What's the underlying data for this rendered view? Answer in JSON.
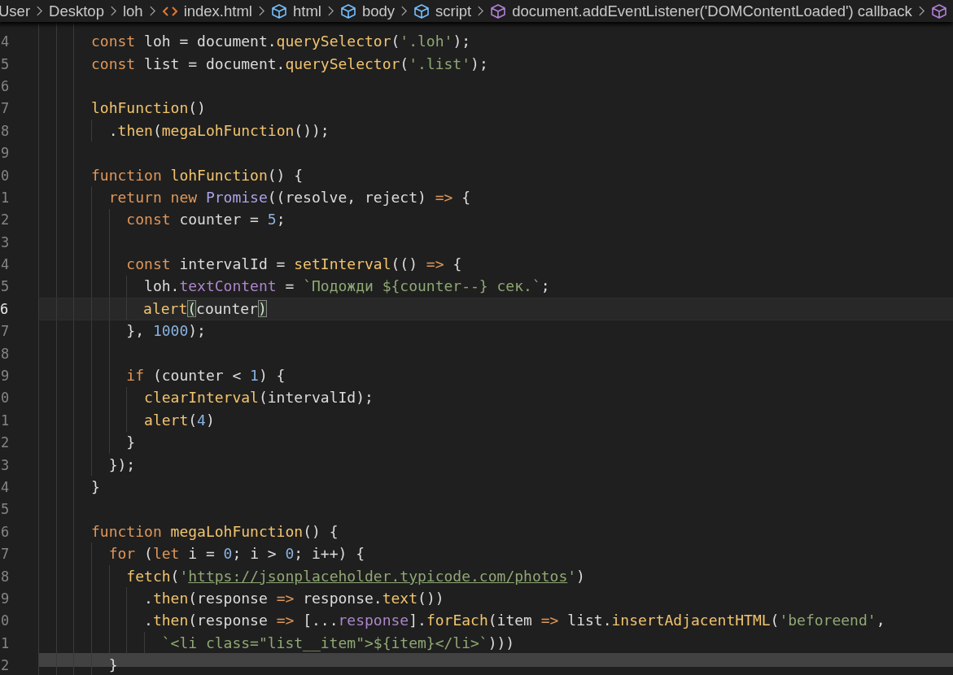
{
  "breadcrumb": [
    {
      "label": "User",
      "kind": "path"
    },
    {
      "label": "Desktop",
      "kind": "path"
    },
    {
      "label": "loh",
      "kind": "path"
    },
    {
      "label": "index.html",
      "kind": "file"
    },
    {
      "label": "html",
      "kind": "element"
    },
    {
      "label": "body",
      "kind": "element"
    },
    {
      "label": "script",
      "kind": "element"
    },
    {
      "label": "document.addEventListener('DOMContentLoaded') callback",
      "kind": "method"
    },
    {
      "kind": "method"
    }
  ],
  "lines": [
    {
      "number": "4",
      "current": false,
      "tokens": [
        {
          "text": "      const",
          "kind": "keyword"
        },
        {
          "text": " loh = document.",
          "kind": "plain"
        },
        {
          "text": "querySelector",
          "kind": "function"
        },
        {
          "text": "(",
          "kind": "plain"
        },
        {
          "text": "'.loh'",
          "kind": "string"
        },
        {
          "text": ");",
          "kind": "plain"
        }
      ]
    },
    {
      "number": "5",
      "current": false,
      "tokens": [
        {
          "text": "      const",
          "kind": "keyword"
        },
        {
          "text": " list = document.",
          "kind": "plain"
        },
        {
          "text": "querySelector",
          "kind": "function"
        },
        {
          "text": "(",
          "kind": "plain"
        },
        {
          "text": "'.list'",
          "kind": "string"
        },
        {
          "text": ");",
          "kind": "plain"
        }
      ]
    },
    {
      "number": "6",
      "current": false
    },
    {
      "number": "7",
      "current": false,
      "tokens": [
        {
          "text": "      lohFunction",
          "kind": "function"
        },
        {
          "text": "()",
          "kind": "plain"
        }
      ]
    },
    {
      "number": "8",
      "current": false,
      "tokens": [
        {
          "text": "        .",
          "kind": "plain"
        },
        {
          "text": "then",
          "kind": "function"
        },
        {
          "text": "(",
          "kind": "plain"
        },
        {
          "text": "megaLohFunction",
          "kind": "function"
        },
        {
          "text": "());",
          "kind": "plain"
        }
      ]
    },
    {
      "number": "9",
      "current": false
    },
    {
      "number": "0",
      "current": false,
      "tokens": [
        {
          "text": "      function ",
          "kind": "keyword"
        },
        {
          "text": "lohFunction",
          "kind": "function"
        },
        {
          "text": "() {",
          "kind": "plain"
        }
      ]
    },
    {
      "number": "1",
      "current": false,
      "tokens": [
        {
          "text": "        return new ",
          "kind": "keyword"
        },
        {
          "text": "Promise",
          "kind": "class"
        },
        {
          "text": "((resolve, reject) ",
          "kind": "plain"
        },
        {
          "text": "=>",
          "kind": "keyword"
        },
        {
          "text": " {",
          "kind": "plain"
        }
      ]
    },
    {
      "number": "2",
      "current": false,
      "tokens": [
        {
          "text": "          const",
          "kind": "keyword"
        },
        {
          "text": " counter = ",
          "kind": "plain"
        },
        {
          "text": "5",
          "kind": "number"
        },
        {
          "text": ";",
          "kind": "plain"
        }
      ]
    },
    {
      "number": "3",
      "current": false
    },
    {
      "number": "4",
      "current": false,
      "tokens": [
        {
          "text": "          const",
          "kind": "keyword"
        },
        {
          "text": " intervalId = ",
          "kind": "plain"
        },
        {
          "text": "setInterval",
          "kind": "function"
        },
        {
          "text": "(() ",
          "kind": "plain"
        },
        {
          "text": "=>",
          "kind": "keyword"
        },
        {
          "text": " {",
          "kind": "plain"
        }
      ]
    },
    {
      "number": "5",
      "current": false,
      "tokens": [
        {
          "text": "            loh.",
          "kind": "plain"
        },
        {
          "text": "textContent",
          "kind": "property"
        },
        {
          "text": " = ",
          "kind": "plain"
        },
        {
          "text": "`Подожди ${counter--} сек.`",
          "kind": "string"
        },
        {
          "text": ";",
          "kind": "plain"
        }
      ]
    },
    {
      "number": "6",
      "current": true,
      "tokens": [
        {
          "text": "            alert",
          "kind": "function"
        },
        {
          "text": "(",
          "kind": "matched-bracket"
        },
        {
          "text": "counter",
          "kind": "plain"
        },
        {
          "text": ")",
          "kind": "matched-bracket"
        }
      ]
    },
    {
      "number": "7",
      "current": false,
      "tokens": [
        {
          "text": "          }, ",
          "kind": "plain"
        },
        {
          "text": "1000",
          "kind": "number"
        },
        {
          "text": ");",
          "kind": "plain"
        }
      ]
    },
    {
      "number": "8",
      "current": false
    },
    {
      "number": "9",
      "current": false,
      "tokens": [
        {
          "text": "          if",
          "kind": "keyword"
        },
        {
          "text": " (counter < ",
          "kind": "plain"
        },
        {
          "text": "1",
          "kind": "number"
        },
        {
          "text": ") {",
          "kind": "plain"
        }
      ]
    },
    {
      "number": "0",
      "current": false,
      "tokens": [
        {
          "text": "            clearInterval",
          "kind": "function"
        },
        {
          "text": "(intervalId);",
          "kind": "plain"
        }
      ]
    },
    {
      "number": "1",
      "current": false,
      "tokens": [
        {
          "text": "            alert",
          "kind": "function"
        },
        {
          "text": "(",
          "kind": "plain"
        },
        {
          "text": "4",
          "kind": "number"
        },
        {
          "text": ")",
          "kind": "plain"
        }
      ]
    },
    {
      "number": "2",
      "current": false,
      "tokens": [
        {
          "text": "          }",
          "kind": "plain"
        }
      ]
    },
    {
      "number": "3",
      "current": false,
      "tokens": [
        {
          "text": "        });",
          "kind": "plain"
        }
      ]
    },
    {
      "number": "4",
      "current": false,
      "tokens": [
        {
          "text": "      }",
          "kind": "plain"
        }
      ]
    },
    {
      "number": "5",
      "current": false
    },
    {
      "number": "6",
      "current": false,
      "tokens": [
        {
          "text": "      function ",
          "kind": "keyword"
        },
        {
          "text": "megaLohFunction",
          "kind": "function"
        },
        {
          "text": "() {",
          "kind": "plain"
        }
      ]
    },
    {
      "number": "7",
      "current": false,
      "tokens": [
        {
          "text": "        for",
          "kind": "keyword"
        },
        {
          "text": " (",
          "kind": "plain"
        },
        {
          "text": "let",
          "kind": "keyword"
        },
        {
          "text": " i = ",
          "kind": "plain"
        },
        {
          "text": "0",
          "kind": "number"
        },
        {
          "text": "; i > ",
          "kind": "plain"
        },
        {
          "text": "0",
          "kind": "number"
        },
        {
          "text": "; i++) {",
          "kind": "plain"
        }
      ]
    },
    {
      "number": "8",
      "current": false,
      "tokens": [
        {
          "text": "          fetch",
          "kind": "function"
        },
        {
          "text": "(",
          "kind": "plain"
        },
        {
          "text": "'",
          "kind": "string"
        },
        {
          "text": "https://jsonplaceholder.typicode.com/photos",
          "kind": "link"
        },
        {
          "text": "'",
          "kind": "string"
        },
        {
          "text": ")",
          "kind": "plain"
        }
      ]
    },
    {
      "number": "9",
      "current": false,
      "tokens": [
        {
          "text": "            .",
          "kind": "plain"
        },
        {
          "text": "then",
          "kind": "function"
        },
        {
          "text": "(response ",
          "kind": "plain"
        },
        {
          "text": "=>",
          "kind": "keyword"
        },
        {
          "text": " response.",
          "kind": "plain"
        },
        {
          "text": "text",
          "kind": "function"
        },
        {
          "text": "())",
          "kind": "plain"
        }
      ]
    },
    {
      "number": "0",
      "current": false,
      "tokens": [
        {
          "text": "            .",
          "kind": "plain"
        },
        {
          "text": "then",
          "kind": "function"
        },
        {
          "text": "(response ",
          "kind": "plain"
        },
        {
          "text": "=>",
          "kind": "keyword"
        },
        {
          "text": " [...",
          "kind": "plain"
        },
        {
          "text": "response",
          "kind": "property"
        },
        {
          "text": "].",
          "kind": "plain"
        },
        {
          "text": "forEach",
          "kind": "function"
        },
        {
          "text": "(item ",
          "kind": "plain"
        },
        {
          "text": "=>",
          "kind": "keyword"
        },
        {
          "text": " list.",
          "kind": "plain"
        },
        {
          "text": "insertAdjacentHTML",
          "kind": "function"
        },
        {
          "text": "(",
          "kind": "plain"
        },
        {
          "text": "'beforeend'",
          "kind": "string"
        },
        {
          "text": ",",
          "kind": "plain"
        }
      ]
    },
    {
      "number": "1",
      "current": false,
      "tokens": [
        {
          "text": "              `<li class=\"list__item\">${item}</li>`",
          "kind": "string"
        },
        {
          "text": ")))",
          "kind": "plain"
        }
      ]
    },
    {
      "number": "2",
      "current": false,
      "tokens": [
        {
          "text": "        }",
          "kind": "plain"
        }
      ]
    }
  ]
}
